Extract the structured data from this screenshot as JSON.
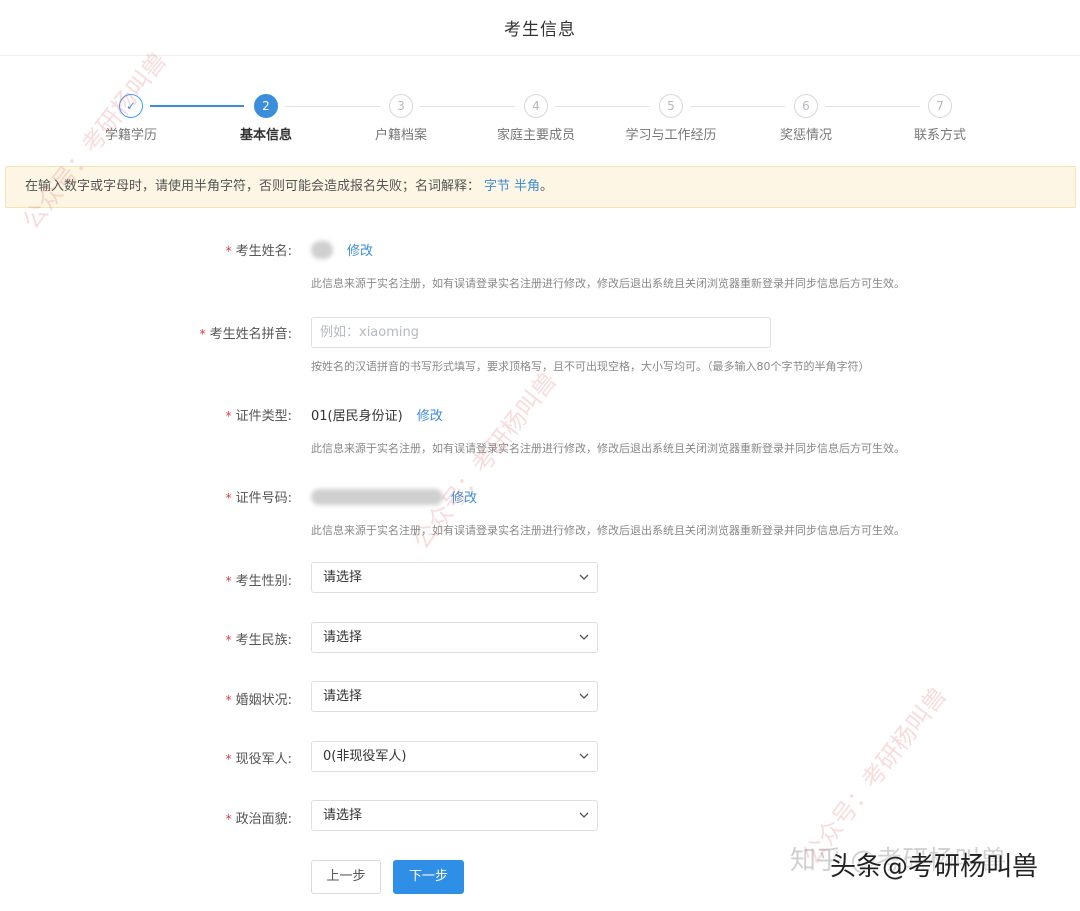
{
  "header": {
    "title": "考生信息"
  },
  "steps": [
    {
      "num": "1",
      "label": "学籍学历",
      "state": "done"
    },
    {
      "num": "2",
      "label": "基本信息",
      "state": "active"
    },
    {
      "num": "3",
      "label": "户籍档案",
      "state": "pending"
    },
    {
      "num": "4",
      "label": "家庭主要成员",
      "state": "pending"
    },
    {
      "num": "5",
      "label": "学习与工作经历",
      "state": "pending"
    },
    {
      "num": "6",
      "label": "奖惩情况",
      "state": "pending"
    },
    {
      "num": "7",
      "label": "联系方式",
      "state": "pending"
    }
  ],
  "notice": {
    "text": "在输入数字或字母时，请使用半角字符，否则可能会造成报名失败；名词解释：",
    "link1": "字节",
    "link2": "半角",
    "end": "。"
  },
  "form": {
    "required_mark": "*",
    "name": {
      "label": "考生姓名:",
      "edit": "修改",
      "hint": "此信息来源于实名注册，如有误请登录实名注册进行修改，修改后退出系统且关闭浏览器重新登录并同步信息后方可生效。"
    },
    "pinyin": {
      "label": "考生姓名拼音:",
      "placeholder": "例如：xiaoming",
      "hint": "按姓名的汉语拼音的书写形式填写，要求顶格写，且不可出现空格，大小写均可。（最多输入80个字节的半角字符）"
    },
    "id_type": {
      "label": "证件类型:",
      "value": "01(居民身份证)",
      "edit": "修改",
      "hint": "此信息来源于实名注册，如有误请登录实名注册进行修改，修改后退出系统且关闭浏览器重新登录并同步信息后方可生效。"
    },
    "id_number": {
      "label": "证件号码:",
      "edit": "修改",
      "hint": "此信息来源于实名注册，如有误请登录实名注册进行修改，修改后退出系统且关闭浏览器重新登录并同步信息后方可生效。"
    },
    "gender": {
      "label": "考生性别:",
      "value": "请选择"
    },
    "ethnicity": {
      "label": "考生民族:",
      "value": "请选择"
    },
    "marital": {
      "label": "婚姻状况:",
      "value": "请选择"
    },
    "military": {
      "label": "现役军人:",
      "value": "0(非现役军人)"
    },
    "political": {
      "label": "政治面貌:",
      "value": "请选择"
    }
  },
  "buttons": {
    "prev": "上一步",
    "next": "下一步"
  },
  "watermarks": {
    "text": "公众号：考研杨叫兽",
    "bottom_faint": "知乎 @考研杨叫兽",
    "bottom_main": "头条@考研杨叫兽"
  },
  "colors": {
    "accent": "#3c8ddb",
    "required": "#e4393c",
    "notice_bg": "#fdf6e4"
  },
  "icons": {
    "done_step": "check-icon",
    "select": "chevron-down-icon"
  }
}
